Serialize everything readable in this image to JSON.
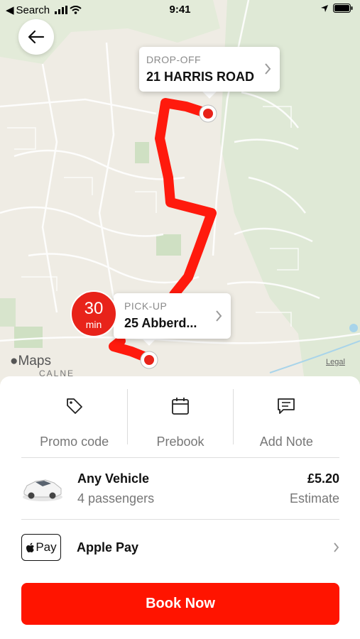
{
  "status_bar": {
    "back_app": "Search",
    "time": "9:41"
  },
  "map": {
    "dropoff": {
      "label": "DROP-OFF",
      "address": "21 HARRIS ROAD"
    },
    "pickup": {
      "label": "PICK-UP",
      "address": "25 Abberd..."
    },
    "eta": {
      "value": "30",
      "unit": "min"
    },
    "attribution": "Maps",
    "legal": "Legal",
    "place_label": "CALNE",
    "route_color": "#ff1a0d"
  },
  "actions": [
    {
      "label": "Promo code",
      "icon": "tag-icon"
    },
    {
      "label": "Prebook",
      "icon": "calendar-icon"
    },
    {
      "label": "Add Note",
      "icon": "note-icon"
    }
  ],
  "vehicle": {
    "name": "Any Vehicle",
    "capacity": "4 passengers",
    "price": "£5.20",
    "price_note": "Estimate",
    "icon": "car-icon"
  },
  "payment": {
    "badge_text": "Pay",
    "method": "Apple Pay"
  },
  "book_button": {
    "label": "Book Now",
    "color": "#ff1400"
  }
}
